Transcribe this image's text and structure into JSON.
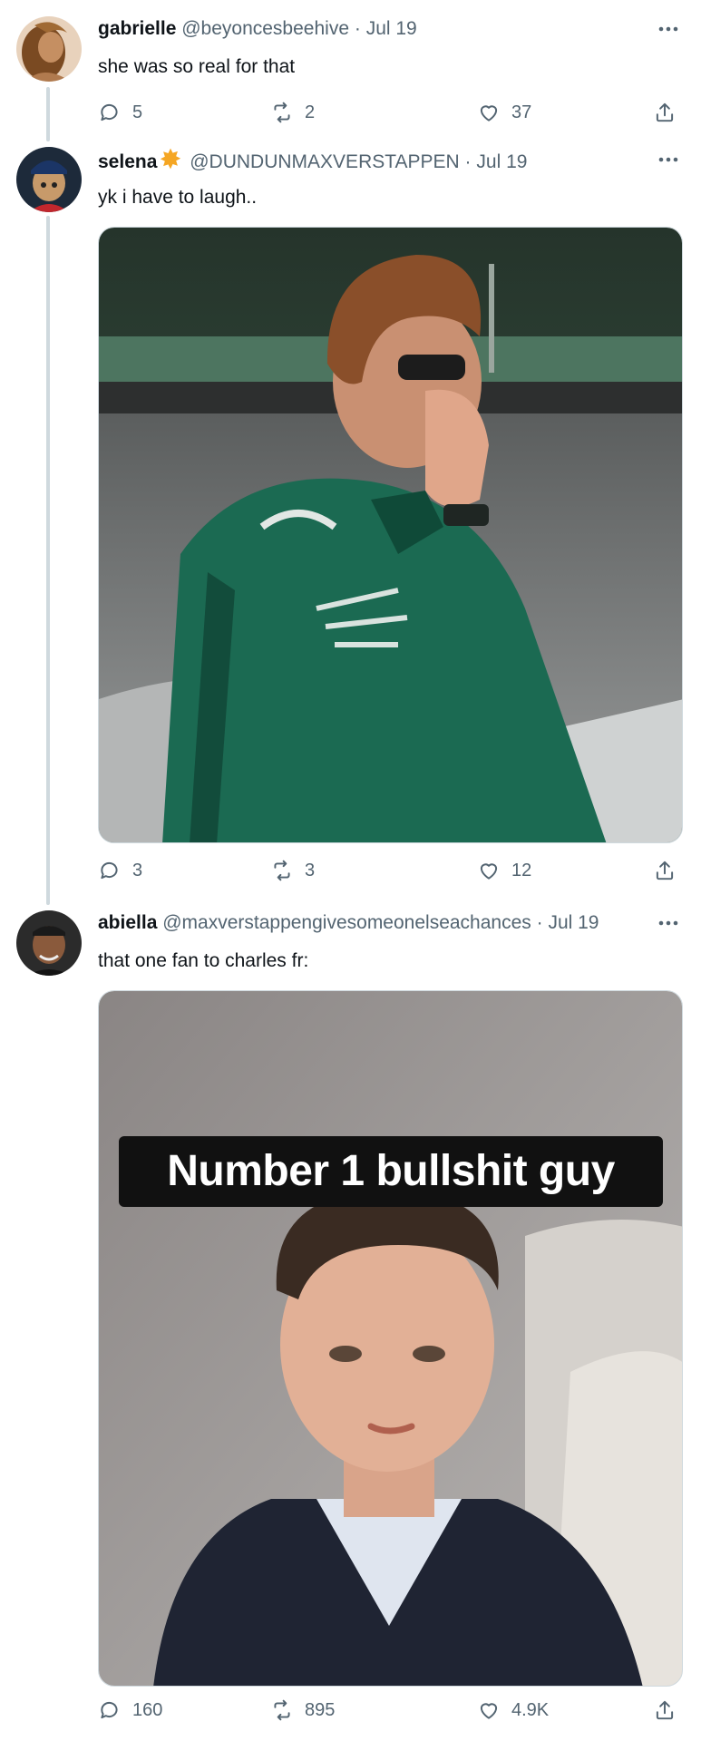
{
  "tweets": [
    {
      "name": "gabrielle",
      "handle": "@beyoncesbeehive",
      "separator": "·",
      "date": "Jul 19",
      "text": "she was so real for that",
      "replies": "5",
      "retweets": "2",
      "likes": "37",
      "avatar_icon": "avatar-photo-woman"
    },
    {
      "name": "selena",
      "badge_icon": "star-badge-icon",
      "handle": "@DUNDUNMAXVERSTAPPEN",
      "separator": "·",
      "date": "Jul 19",
      "text": "yk i have to laugh..",
      "replies": "3",
      "retweets": "3",
      "likes": "12",
      "avatar_icon": "avatar-photo-cartoon-racer",
      "media_desc": "photo of driver in green racing suit covering face"
    },
    {
      "name": "abiella",
      "handle": "@maxverstappengivesomeonelseachances",
      "separator": "·",
      "date": "Jul 19",
      "text": "that one fan to charles fr:",
      "replies": "160",
      "retweets": "895",
      "likes": "4.9K",
      "avatar_icon": "avatar-photo-man",
      "media_caption": "Number 1 bullshit guy"
    }
  ],
  "colors": {
    "text": "#0f1419",
    "muted": "#536471",
    "thread_line": "#cfd9de",
    "badge": "#f5a623"
  }
}
